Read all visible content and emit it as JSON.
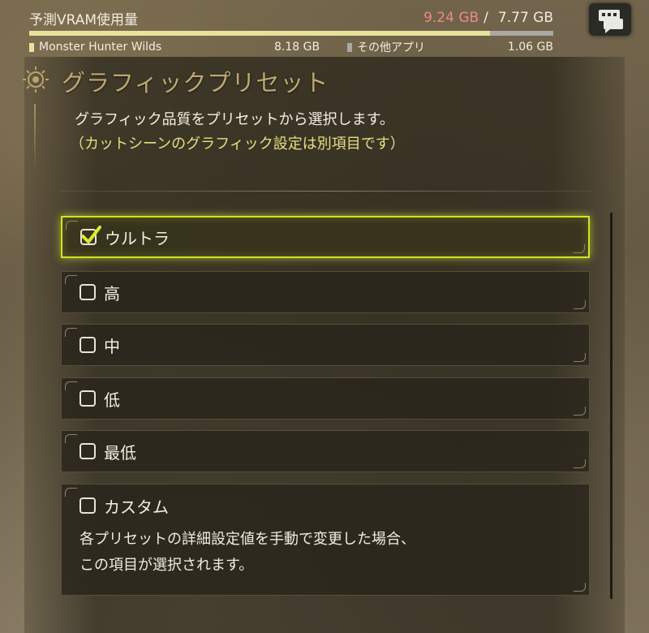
{
  "vram": {
    "title": "予測VRAM使用量",
    "used": "9.24 GB",
    "separator": "/",
    "total": "7.77 GB",
    "usage_fraction_game": 0.88,
    "usage_fraction_other": 0.12,
    "game_label": "Monster Hunter Wilds",
    "game_size": "8.18 GB",
    "other_label": "その他アプリ",
    "other_size": "1.06 GB",
    "colors": {
      "game": "#e7e39b",
      "other": "#a9a8a2",
      "over": "#e88a86"
    }
  },
  "chat_icon": "chat-bubbles-icon",
  "section": {
    "title": "グラフィックプリセット",
    "description": "グラフィック品質をプリセットから選択します。",
    "note": "（カットシーンのグラフィック設定は別項目です）"
  },
  "options": [
    {
      "label": "ウルトラ",
      "checked": true
    },
    {
      "label": "高",
      "checked": false
    },
    {
      "label": "中",
      "checked": false
    },
    {
      "label": "低",
      "checked": false
    },
    {
      "label": "最低",
      "checked": false
    },
    {
      "label": "カスタム",
      "checked": false,
      "description_line1": "各プリセットの詳細設定値を手動で変更した場合、",
      "description_line2": "この項目が選択されます。"
    }
  ],
  "accent_color": "#cfe22a"
}
